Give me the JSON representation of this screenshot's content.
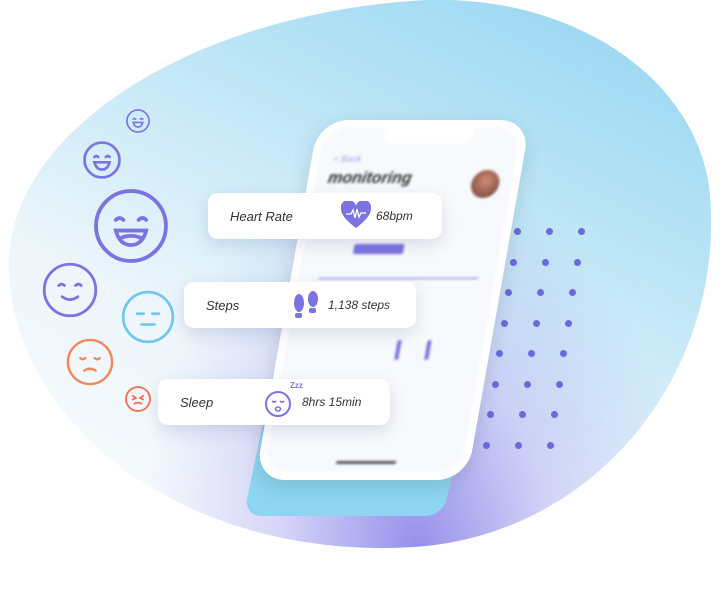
{
  "phone": {
    "back_label": "< Back",
    "title": "monitoring"
  },
  "cards": [
    {
      "label": "Heart Rate",
      "value": "68bpm",
      "icon": "heart-pulse-icon"
    },
    {
      "label": "Steps",
      "value": "1,138 steps",
      "icon": "footprints-icon"
    },
    {
      "label": "Sleep",
      "value": "8hrs 15min",
      "icon": "sleeping-face-icon",
      "badge": "Zzz"
    }
  ],
  "colors": {
    "accent": "#7b74e0",
    "sky": "#8dd5f0",
    "happy": "#7b74e0",
    "neutral": "#6fc6ee",
    "sad": "#f08a5d",
    "angry": "#f0704a"
  },
  "moods": [
    "laughing",
    "happy",
    "grinning",
    "content",
    "neutral",
    "sad",
    "angry"
  ]
}
